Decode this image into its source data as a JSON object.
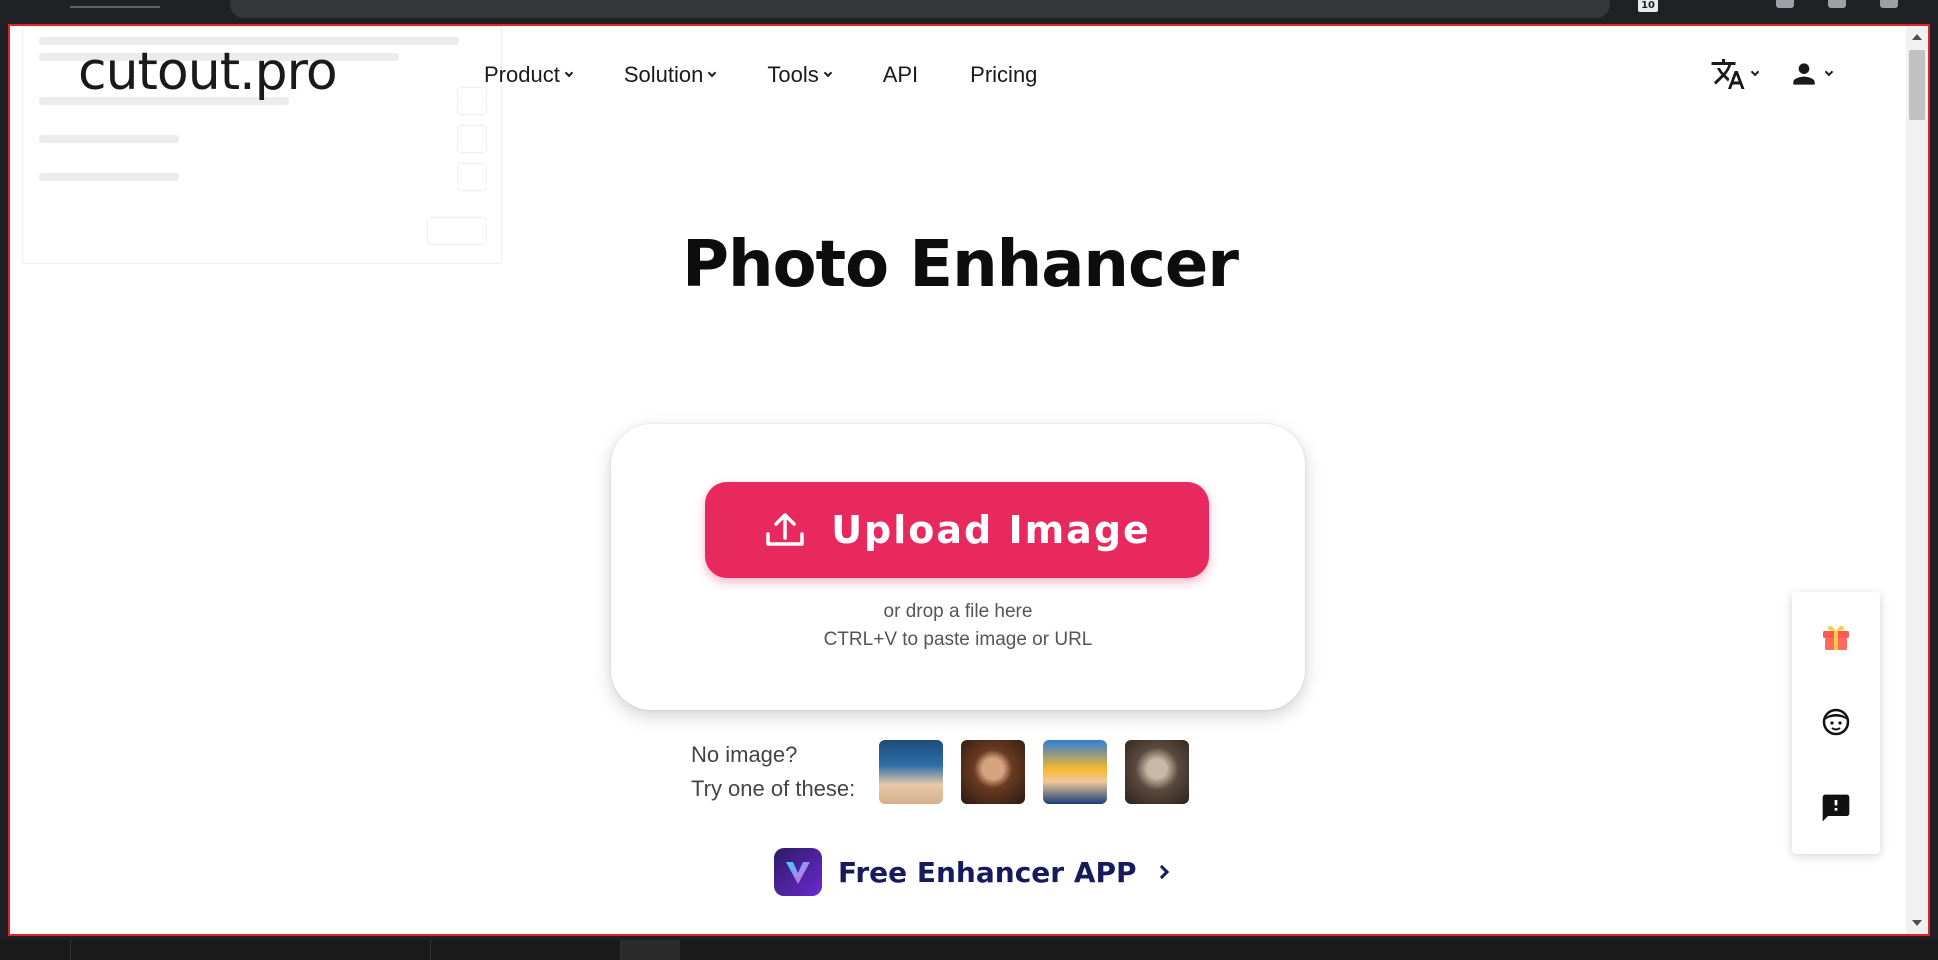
{
  "site": {
    "logo": "cutout.pro"
  },
  "nav": {
    "items": [
      {
        "label": "Product",
        "has_dropdown": true
      },
      {
        "label": "Solution",
        "has_dropdown": true
      },
      {
        "label": "Tools",
        "has_dropdown": true
      },
      {
        "label": "API",
        "has_dropdown": false
      },
      {
        "label": "Pricing",
        "has_dropdown": false
      }
    ],
    "language_icon": "translate-icon",
    "account_icon": "user-icon"
  },
  "browser": {
    "tab_count": "10"
  },
  "hero": {
    "title": "Photo Enhancer",
    "upload_label": "Upload Image",
    "drop_hint": "or drop a file here",
    "paste_hint": "CTRL+V to paste image or URL"
  },
  "samples": {
    "label_line1": "No image?",
    "label_line2": "Try one of these:",
    "count": 4
  },
  "app_promo": {
    "label": "Free Enhancer APP"
  },
  "side_panel": {
    "icons": [
      "gift-icon",
      "support-agent-icon",
      "feedback-icon"
    ]
  },
  "colors": {
    "accent": "#e8295e",
    "app_text": "#151b5e",
    "frame_border": "#e0242b"
  }
}
